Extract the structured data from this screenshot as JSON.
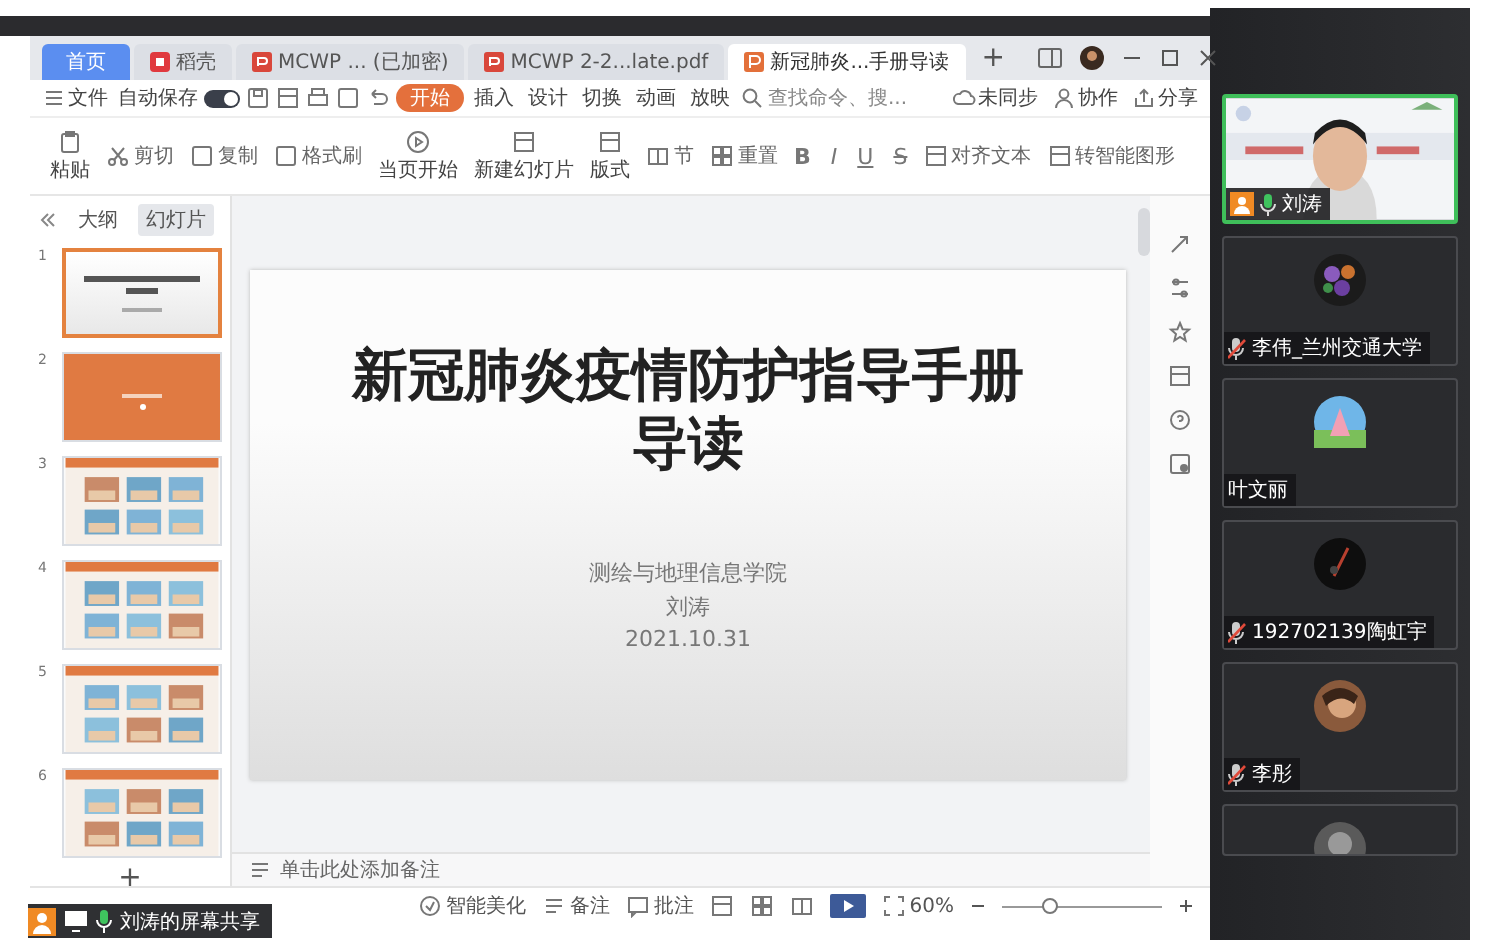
{
  "tabs": [
    {
      "label": "首页",
      "kind": "home",
      "selected": false
    },
    {
      "label": "稻壳",
      "kind": "docer",
      "selected": false
    },
    {
      "label": "MCWP ... (已加密)",
      "kind": "pdf",
      "selected": false
    },
    {
      "label": "MCWP 2-2...late.pdf",
      "kind": "pdf",
      "selected": false
    },
    {
      "label": "新冠肺炎...手册导读",
      "kind": "ppt",
      "selected": true
    }
  ],
  "new_tab": "+",
  "menu": {
    "file": "文件",
    "autosave": {
      "label": "自动保存",
      "on": true
    },
    "items": [
      {
        "label": "开始",
        "selected": true
      },
      {
        "label": "插入",
        "selected": false
      },
      {
        "label": "设计",
        "selected": false
      },
      {
        "label": "切换",
        "selected": false
      },
      {
        "label": "动画",
        "selected": false
      },
      {
        "label": "放映",
        "selected": false
      }
    ],
    "search": {
      "placeholder": "查找命令、搜..."
    },
    "actions": [
      {
        "label": "未同步",
        "kind": "cloud"
      },
      {
        "label": "协作",
        "kind": "person"
      },
      {
        "label": "分享",
        "kind": "share"
      }
    ]
  },
  "ribbon": {
    "items": [
      {
        "label": "粘贴",
        "kind": "big"
      },
      {
        "label": "剪切",
        "kind": "small"
      },
      {
        "label": "复制",
        "kind": "small"
      },
      {
        "label": "格式刷",
        "kind": "small"
      },
      {
        "label": "当页开始",
        "kind": "big"
      },
      {
        "label": "新建幻灯片",
        "kind": "big"
      },
      {
        "label": "版式",
        "kind": "big"
      },
      {
        "label": "节",
        "kind": "small"
      },
      {
        "label": "重置",
        "kind": "small"
      }
    ],
    "format": [
      "B",
      "I",
      "U",
      "S"
    ],
    "extras": [
      {
        "label": "对齐文本"
      },
      {
        "label": "转智能图形"
      }
    ]
  },
  "panel": {
    "tabs": [
      {
        "label": "大纲",
        "selected": false
      },
      {
        "label": "幻灯片",
        "selected": true
      }
    ],
    "slides": [
      {
        "number": "1",
        "kind": "title",
        "selected": true
      },
      {
        "number": "2",
        "kind": "orange",
        "selected": false
      },
      {
        "number": "3",
        "kind": "pictures",
        "selected": false
      },
      {
        "number": "4",
        "kind": "pictures",
        "selected": false
      },
      {
        "number": "5",
        "kind": "pictures",
        "selected": false
      },
      {
        "number": "6",
        "kind": "pictures",
        "selected": false
      }
    ],
    "add": "+"
  },
  "slide": {
    "title": "新冠肺炎疫情防护指导手册导读",
    "lines": [
      "测绘与地理信息学院",
      "刘涛",
      "2021.10.31"
    ]
  },
  "notes": {
    "placeholder": "单击此处添加备注"
  },
  "status": {
    "items": [
      {
        "label": "智能美化",
        "kind": "beautify"
      },
      {
        "label": "备注",
        "kind": "notes"
      },
      {
        "label": "批注",
        "kind": "comment"
      }
    ],
    "zoom": "60%",
    "zoom_slider": {
      "level": 0.3
    }
  },
  "share_bar": {
    "label": "刘涛的屏幕共享"
  },
  "participants": [
    {
      "name": "刘涛",
      "kind": "video",
      "muted": false,
      "speaking": true
    },
    {
      "name": "李伟_兰州交通大学",
      "kind": "avatar",
      "muted": true,
      "speaking": false
    },
    {
      "name": "叶文丽",
      "kind": "avatar",
      "speaking": false
    },
    {
      "name": "192702139陶虹宇",
      "kind": "avatar",
      "muted": true,
      "speaking": false
    },
    {
      "name": "李彤",
      "kind": "avatar",
      "muted": true,
      "speaking": false
    },
    {
      "kind": "cut"
    }
  ]
}
